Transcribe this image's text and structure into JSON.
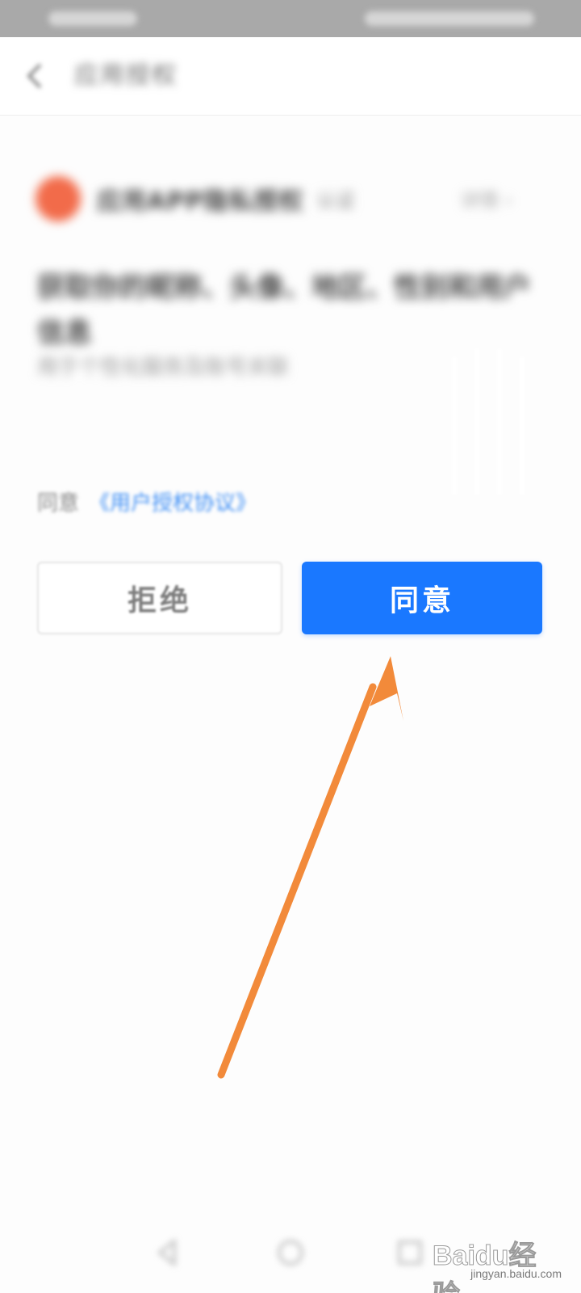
{
  "header": {
    "title": "应用授权"
  },
  "app": {
    "name": "应用APP隐私授权",
    "tag": "认证",
    "more": "详情 ›"
  },
  "permission": {
    "title": "获取你的昵称、头像、地区、性别和用户信息",
    "description": "用于个性化服务及账号关联"
  },
  "agreement": {
    "prefix": "同意",
    "link": "《用户授权协议》"
  },
  "buttons": {
    "reject": "拒绝",
    "agree": "同意"
  },
  "watermark": {
    "brand": "Baidu经验",
    "url": "jingyan.baidu.com"
  },
  "colors": {
    "agree_button": "#1a78ff",
    "arrow": "#f28a3a",
    "link": "#3f8ff5"
  },
  "icons": {
    "back": "chevron-left-icon",
    "nav_back": "triangle-back-icon",
    "nav_home": "circle-home-icon",
    "nav_recent": "square-recent-icon"
  }
}
